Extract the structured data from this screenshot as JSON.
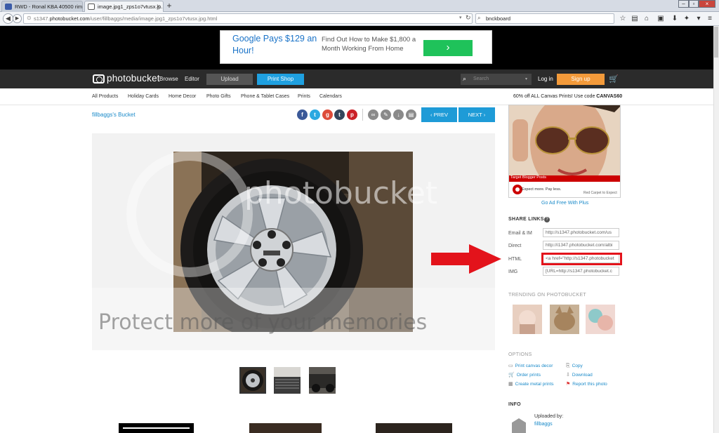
{
  "browser": {
    "tabs": [
      {
        "label": "RWD - Ronal KBA 40500 rims"
      },
      {
        "label": "image.jpg1_zps1o7vtusx.jp..."
      }
    ],
    "url_prefix": "s1347.",
    "url_host": "photobucket.com",
    "url_path": "/user/fillbaggs/media/image.jpg1_zps1o7vtusx.jpg.html",
    "search_value": "bnckboard"
  },
  "ad": {
    "title": "Google Pays $129 an Hour!",
    "text": "Find Out How to Make $1,800 a Month Working From Home",
    "button_glyph": "›"
  },
  "photobucket": {
    "logo_text": "photobucket",
    "nav": [
      "Browse",
      "Editor"
    ],
    "upload_label": "Upload",
    "print_label": "Print Shop",
    "search_placeholder": "Search",
    "login_label": "Log in",
    "signup_label": "Sign up"
  },
  "categories": [
    "All Products",
    "Holiday Cards",
    "Home Decor",
    "Photo Gifts",
    "Phone & Tablet Cases",
    "Prints",
    "Calendars"
  ],
  "promo": {
    "text": "60% off ALL Canvas Prints! Use code ",
    "code": "CANVAS60"
  },
  "bucket_label": "fillbaggs's Bucket",
  "pager": {
    "prev": "‹ PREV",
    "next": "NEXT ›"
  },
  "watermark": {
    "logo": "photobucket",
    "tagline": "Protect more of your memories"
  },
  "sidebar": {
    "ad_banner_title": "Target Blogger Posts",
    "ad_banner_slogan": "Expect more. Pay less.",
    "ad_banner_link": "Red Carpet to Expect",
    "go_free": "Go Ad Free With Plus",
    "share_heading": "SHARE LINKS",
    "share_links": [
      {
        "label": "Email & IM",
        "value": "http://s1347.photobucket.com/us"
      },
      {
        "label": "Direct",
        "value": "http://i1347.photobucket.com/albi"
      },
      {
        "label": "HTML",
        "value": "<a href=\"http://s1347.photobucket"
      },
      {
        "label": "IMG",
        "value": "[URL=http://s1347.photobucket.c"
      }
    ],
    "trending_heading": "TRENDING ON PHOTOBUCKET",
    "options_heading": "OPTIONS",
    "options": [
      {
        "label": "Print canvas decor",
        "icon": "canvas-icon",
        "glyph": "▭"
      },
      {
        "label": "Copy",
        "icon": "copy-icon",
        "glyph": "⎘"
      },
      {
        "label": "Order prints",
        "icon": "cart-icon",
        "glyph": "🛒"
      },
      {
        "label": "Download",
        "icon": "download-icon",
        "glyph": "⇩"
      },
      {
        "label": "Create metal prints",
        "icon": "metal-print-icon",
        "glyph": "▦"
      },
      {
        "label": "Report this photo",
        "icon": "flag-icon",
        "glyph": "⚑"
      }
    ],
    "info_heading": "INFO",
    "uploaded_by": "Uploaded by:",
    "uploader": "fillbaggs"
  },
  "colors": {
    "accent": "#1e9bd7",
    "signup": "#f39a3a",
    "highlight": "#e3131b"
  }
}
